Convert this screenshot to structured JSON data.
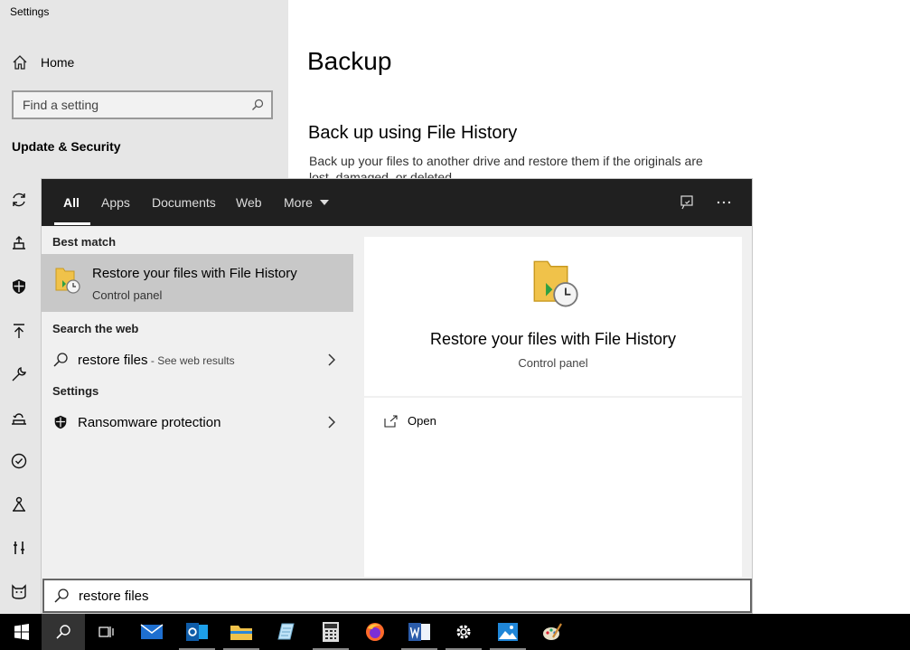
{
  "settings": {
    "window_title": "Settings",
    "home_label": "Home",
    "find_placeholder": "Find a setting",
    "section": "Update & Security",
    "sidebar_icons": [
      "sync-icon",
      "delivery-icon",
      "shield-icon",
      "backup-arrow-icon",
      "wrench-icon",
      "recovery-icon",
      "check-circle-icon",
      "find-device-icon",
      "developer-icon",
      "insider-cat-icon"
    ]
  },
  "main": {
    "title": "Backup",
    "fh_title": "Back up using File History",
    "fh_desc": "Back up your files to another drive and restore them if the originals are lost, damaged, or deleted."
  },
  "search": {
    "tabs": [
      "All",
      "Apps",
      "Documents",
      "Web",
      "More"
    ],
    "best_match_label": "Best match",
    "best_match_title": "Restore your files with File History",
    "best_match_sub": "Control panel",
    "web_label": "Search the web",
    "web_query": "restore files",
    "web_suffix": " - See web results",
    "settings_label": "Settings",
    "settings_item": "Ransomware protection",
    "preview_title": "Restore your files with File History",
    "preview_sub": "Control panel",
    "open_label": "Open",
    "query": "restore files"
  },
  "taskbar": {
    "items": [
      "start-icon",
      "search-icon",
      "task-view-icon",
      "mail-icon",
      "outlook-icon",
      "file-explorer-icon",
      "notepad-icon",
      "calculator-icon",
      "firefox-icon",
      "word-icon",
      "settings-gear-icon",
      "photos-icon",
      "paint-icon"
    ]
  },
  "colors": {
    "search_header": "#202020",
    "selected_result": "#c8c8c8",
    "settings_sidebar": "#e6e6e6"
  }
}
